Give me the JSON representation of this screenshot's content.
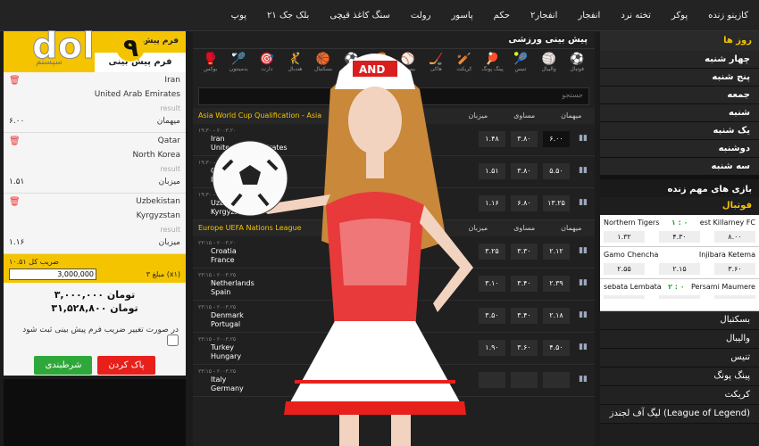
{
  "topnav": {
    "items": [
      "کازینو زنده",
      "پوکر",
      "تخته نرد",
      "انفجار",
      "انفجار۲",
      "حکم",
      "پاسور",
      "رولت",
      "سنگ کاغذ قیچی",
      "بلک جک ۲۱",
      "پوپ"
    ]
  },
  "betslip": {
    "header": "فرم پیش بینی",
    "tab_active": "فرم پیش بینی",
    "tab_inactive": "سیستم",
    "items": [
      {
        "team1": "Iran",
        "team2": "United Arab Emirates",
        "result": "result",
        "pick": "میهمان",
        "odd": "۶.۰۰"
      },
      {
        "team1": "Qatar",
        "team2": "North Korea",
        "result": "result",
        "pick": "میزبان",
        "odd": "۱.۵۱"
      },
      {
        "team1": "Uzbekistan",
        "team2": "Kyrgyzstan",
        "result": "result",
        "pick": "میزبان",
        "odd": "۱.۱۶"
      }
    ],
    "total_odds_label": "ضریب کل ۱۰.۵۱",
    "count_label": "۳ مبلغ (x۱)",
    "amount_value": "3,000,000",
    "stake": "۳,۰۰۰,۰۰۰ تومان",
    "win": "۳۱,۵۲۸,۸۰۰ تومان",
    "checkbox_label": "در صورت تغییر ضریب فرم پیش بینی ثبت شود",
    "clear_button": "پاک کردن",
    "submit_button": "شرطبندی"
  },
  "center": {
    "title": "پیش بینی ورزشی",
    "search_placeholder": "جستجو",
    "sports": [
      "فوتبال",
      "والیبال",
      "تنیس",
      "پینگ پونگ",
      "کریکت",
      "هاکی",
      "بیسبال",
      "راگبی",
      "فوتسال",
      "بسکتبال",
      "هندبال",
      "دارت",
      "بدمینتون",
      "بوکس"
    ],
    "league1": "Asia World Cup Qualification - Asia",
    "league2": "Europe UEFA Nations League",
    "cols": [
      "میهمان",
      "مساوی",
      "میزبان"
    ],
    "matches1": [
      {
        "date": "۱۹:۳۰ - ۲۰۰۳.۲۰",
        "t1": "Iran",
        "t2": "United Arab Emirates",
        "o1": "۱.۴۸",
        "x": "۳.۸۰",
        "o2": "۶.۰۰"
      },
      {
        "date": "۱۹:۳۰ - ۲۰۰۳.۲۰",
        "t1": "Qatar",
        "t2": "North Korea",
        "o1": "۱.۵۱",
        "x": "۳.۸۰",
        "o2": "۵.۵۰"
      },
      {
        "date": "۱۹:۳۰ - ۲۰۰۳.۲۰",
        "t1": "Uzbekistan",
        "t2": "Kyrgyzstan",
        "o1": "۱.۱۶",
        "x": "۶.۸۰",
        "o2": "۱۳.۲۵"
      }
    ],
    "matches2": [
      {
        "date": "۲۳:۱۵ - ۲۰۰۳.۲۰",
        "t1": "Croatia",
        "t2": "France",
        "o1": "۳.۲۵",
        "x": "۳.۳۰",
        "o2": "۲.۱۲"
      },
      {
        "date": "۲۳:۱۵ - ۲۰۰۳.۲۵",
        "t1": "Netherlands",
        "t2": "Spain",
        "o1": "۳.۱۰",
        "x": "۳.۴۰",
        "o2": "۲.۳۹"
      },
      {
        "date": "۲۳:۱۵ - ۲۰۰۳.۲۵",
        "t1": "Denmark",
        "t2": "Portugal",
        "o1": "۳.۵۰",
        "x": "۳.۴۰",
        "o2": "۲.۱۸"
      },
      {
        "date": "۲۳:۱۵ - ۲۰۰۳.۲۵",
        "t1": "Turkey",
        "t2": "Hungary",
        "o1": "۱.۹۰",
        "x": "۳.۶۰",
        "o2": "۴.۵۰"
      },
      {
        "date": "۲۳:۱۵ - ۲۰۰۳.۲۵",
        "t1": "Italy",
        "t2": "Germany",
        "o1": "",
        "x": "",
        "o2": ""
      }
    ]
  },
  "right": {
    "days_header": "روز ها",
    "days": [
      "چهار شنبه",
      "پنج شنبه",
      "جمعه",
      "شنبه",
      "یک شنبه",
      "دوشنبه",
      "سه شنبه"
    ],
    "live_header": "بازی های مهم زنده",
    "football": "فوتبال",
    "live": [
      {
        "home": "Northern Tigers",
        "score": "۱ : ۰",
        "away": "est Killarney FC",
        "o1": "۱.۳۲",
        "x": "۴.۳۰",
        "o2": "۸.۰۰"
      },
      {
        "home": "Gamo Chencha",
        "score": "",
        "away": "Injibara Ketema",
        "o1": "۲.۵۵",
        "x": "۲.۱۵",
        "o2": "۳.۶۰"
      },
      {
        "home": "sebata Lembata",
        "score": "۲ : ۰",
        "away": "Persami Maumere",
        "o1": "",
        "x": "",
        "o2": ""
      }
    ],
    "sports": [
      "بسکتبال",
      "والیبال",
      "تنیس",
      "پینگ پونگ",
      "کریکت",
      "لیگ آف لجندز (League of Legend)"
    ]
  },
  "colors": {
    "accent": "#f4c400",
    "bg": "#1b1b1b",
    "red": "#e8201c",
    "green": "#2ea83a"
  }
}
